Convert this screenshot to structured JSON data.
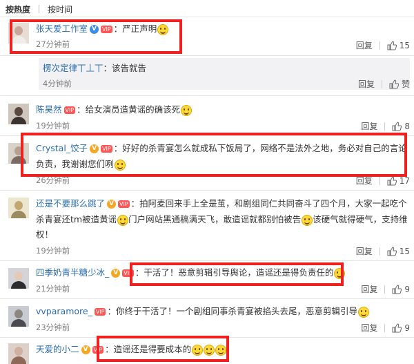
{
  "tabs": {
    "hot": "按热度",
    "time": "按时间"
  },
  "comments": [
    {
      "name": "张天爱工作室",
      "text": "严正声明",
      "time": "27分钟前",
      "reply": "回复",
      "likes": "15"
    },
    {
      "name": "楞次定律丅丄丅",
      "text": "：该告就告",
      "time": "4分钟前",
      "reply": "回复",
      "likes": "赞"
    },
    {
      "name": "陈昊然",
      "text": "：给女演员造黄谣的确该死",
      "time": "19分钟前",
      "reply": "回复",
      "likes": "8"
    },
    {
      "name": "Crystal_饺子",
      "text1": "：好好的杀青宴怎么就成私下饭局了，网络不是法外之地，务必对自己的言论",
      "text2": "负责，我谢谢您们咧",
      "time": "26分钟前",
      "reply": "回复",
      "likes": "17"
    },
    {
      "name": "还是不要那么跳了",
      "text1": "：拍阿麦回来手上全是茧，和剧组同仁共同奋斗了四个月，大家一起吃个",
      "text2a": "杀青宴还tm被造黄谣",
      "text2b": "门户网站黑通稿满天飞，敢造谣就都别怕被告",
      "text2c": "该硬气就得硬气，支持维",
      "text3": "权！",
      "time": "19分钟前",
      "reply": "回复",
      "likes": "15"
    },
    {
      "name": "四季奶青半糖少冰_",
      "text": "：干活了！恶意剪辑引导舆论，造谣还是得负责任的",
      "time": "21分钟前",
      "reply": "回复",
      "likes": "9"
    },
    {
      "name": "vvparamore_",
      "text": "：你终于干活了！一个剧组同事杀青宴被掐头去尾，恶意剪辑引导",
      "time": "23分钟前",
      "reply": "回复",
      "likes": "9"
    },
    {
      "name": "天爱的小二",
      "text": "：造谣还是得要成本的",
      "time": "",
      "reply": "",
      "likes": ""
    }
  ],
  "colors": {
    "highlight": "#ee2020",
    "name_orange": "#eb7350",
    "name_blue": "#2b6dad"
  },
  "icons": [
    "verified-icon",
    "vip-badge-icon",
    "smile-emoji-icon",
    "thumbs-up-icon",
    "avatar-icon"
  ]
}
